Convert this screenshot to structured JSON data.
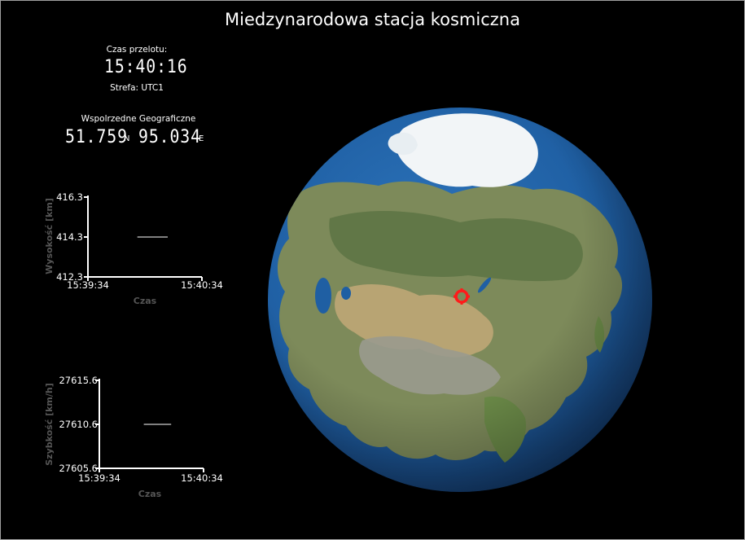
{
  "window": {
    "title": "Miedzynarodowa stacja kosmiczna"
  },
  "flyover": {
    "label": "Czas przelotu:",
    "time": "15:40:16",
    "zone_label": "Strefa: UTC1"
  },
  "coords": {
    "label": "Wspolrzedne Geograficzne",
    "lat": "51.759",
    "lat_hemi": "N",
    "lon": "95.034",
    "lon_hemi": "E"
  },
  "altitude_chart": {
    "ylabel": "Wysokość [km]",
    "xlabel": "Czas",
    "yticks": [
      "416.3",
      "414.3",
      "412.3"
    ],
    "xticks": [
      "15:39:34",
      "15:40:34"
    ]
  },
  "speed_chart": {
    "ylabel": "Szybkość [km/h]",
    "xlabel": "Czas",
    "yticks": [
      "27615.6",
      "27610.6",
      "27605.6"
    ],
    "xticks": [
      "15:39:34",
      "15:40:34"
    ]
  },
  "chart_data": [
    {
      "type": "line",
      "ylabel": "Wysokość [km]",
      "xlabel": "Czas",
      "xlim": [
        "15:39:34",
        "15:40:34"
      ],
      "ylim": [
        412.3,
        416.3
      ],
      "series": [
        {
          "x": [
            "15:40:00",
            "15:40:16"
          ],
          "values": [
            414.3,
            414.3
          ]
        }
      ]
    },
    {
      "type": "line",
      "ylabel": "Szybkość [km/h]",
      "xlabel": "Czas",
      "xlim": [
        "15:39:34",
        "15:40:34"
      ],
      "ylim": [
        27605.6,
        27615.6
      ],
      "series": [
        {
          "x": [
            "15:40:00",
            "15:40:16"
          ],
          "values": [
            27610.6,
            27610.6
          ]
        }
      ]
    }
  ],
  "globe": {
    "marker_color": "#ff1a1a",
    "ocean_color": "#1f5fa3"
  }
}
